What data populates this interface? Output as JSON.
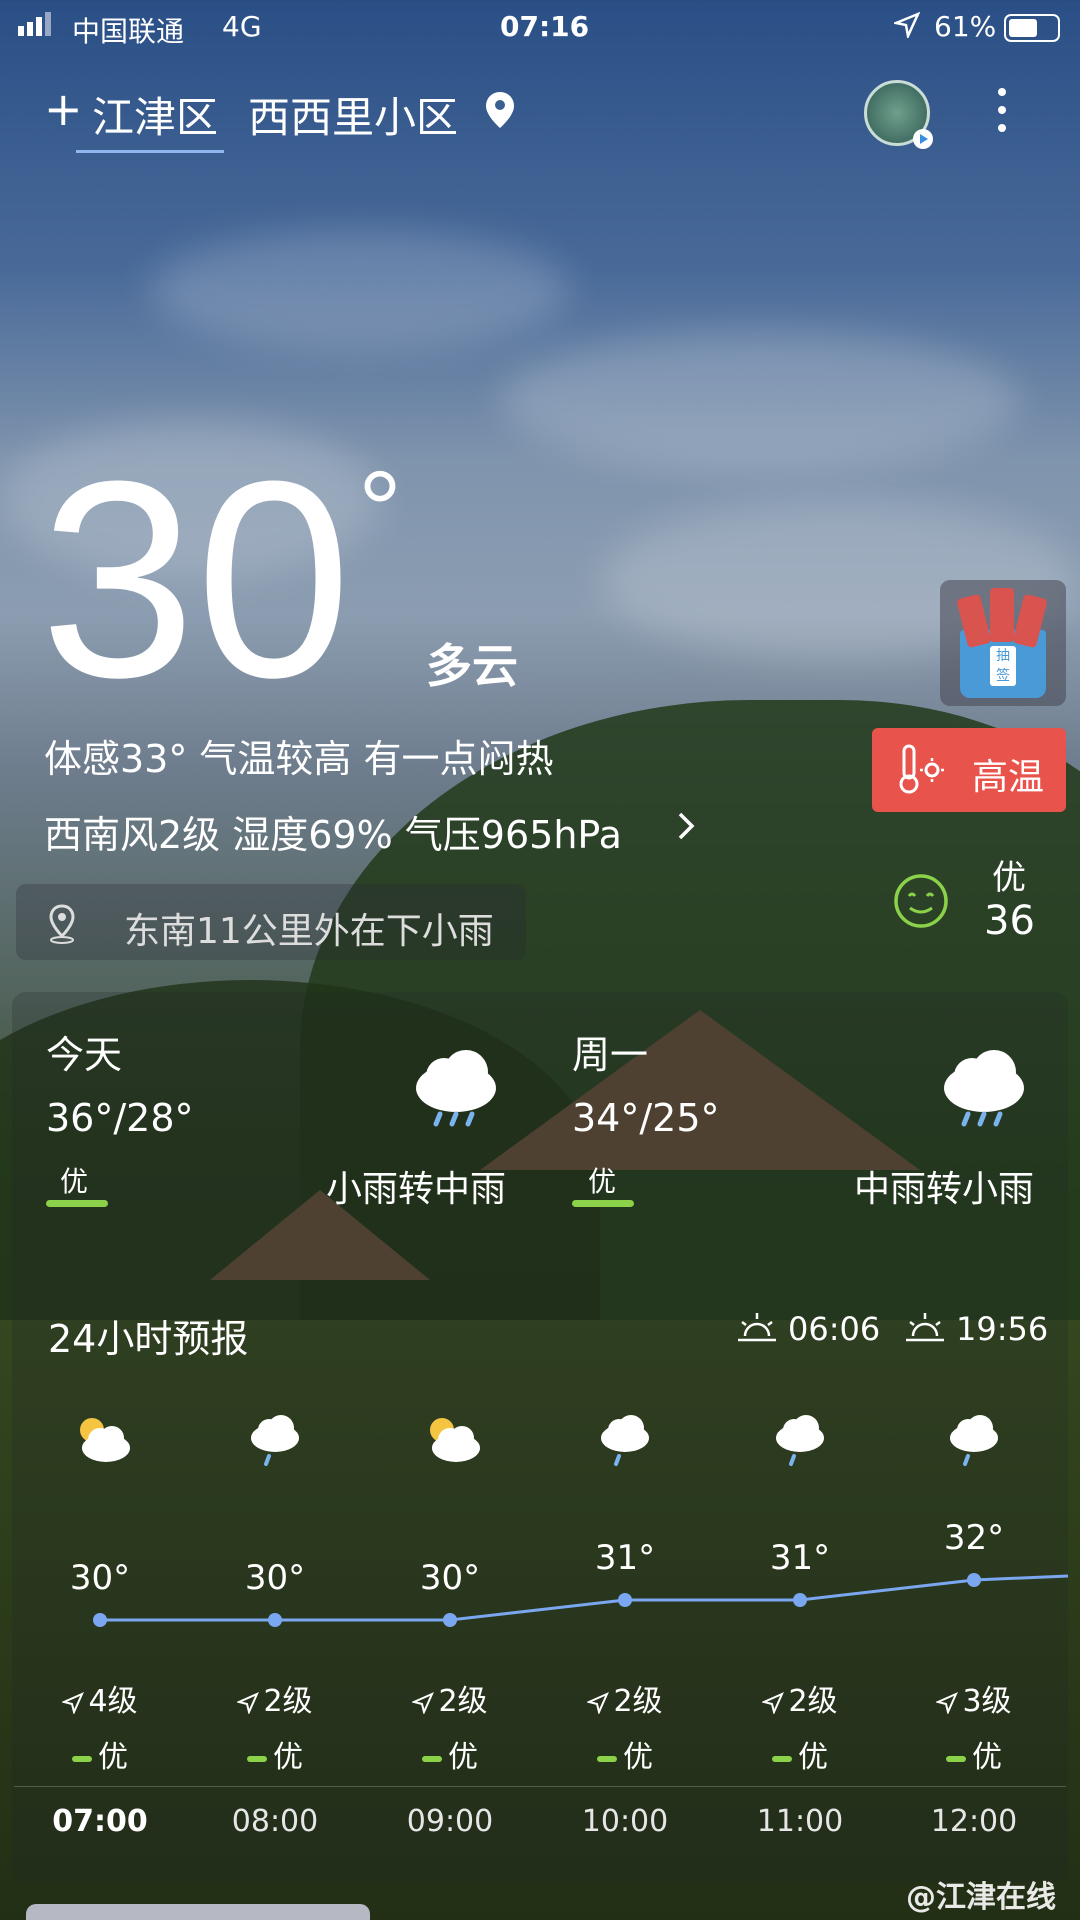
{
  "status": {
    "carrier": "中国联通",
    "network": "4G",
    "time": "07:16",
    "battery": "61%"
  },
  "header": {
    "add": "+",
    "district": "江津区",
    "community": "西西里小区"
  },
  "current": {
    "temp": "30",
    "degree": "°",
    "condition": "多云",
    "feels": "体感33° 气温较高 有一点闷热",
    "details": "西南风2级 湿度69% 气压965hPa",
    "rain_notice": "东南11公里外在下小雨"
  },
  "side": {
    "fortune": "抽签",
    "alert": "高温",
    "aqi_label": "优",
    "aqi_value": "36"
  },
  "daily": [
    {
      "day": "今天",
      "range": "36°/28°",
      "aqi": "优",
      "condition": "小雨转中雨"
    },
    {
      "day": "周一",
      "range": "34°/25°",
      "aqi": "优",
      "condition": "中雨转小雨"
    }
  ],
  "hourly_title": "24小时预报",
  "sunrise": "06:06",
  "sunset": "19:56",
  "hours": [
    {
      "temp": "30°",
      "wind": "4级",
      "aqi": "优",
      "time": "07:00",
      "icon": "partly-cloudy-icon"
    },
    {
      "temp": "30°",
      "wind": "2级",
      "aqi": "优",
      "time": "08:00",
      "icon": "rain-icon"
    },
    {
      "temp": "30°",
      "wind": "2级",
      "aqi": "优",
      "time": "09:00",
      "icon": "partly-cloudy-icon"
    },
    {
      "temp": "31°",
      "wind": "2级",
      "aqi": "优",
      "time": "10:00",
      "icon": "rain-icon"
    },
    {
      "temp": "31°",
      "wind": "2级",
      "aqi": "优",
      "time": "11:00",
      "icon": "rain-icon"
    },
    {
      "temp": "32°",
      "wind": "3级",
      "aqi": "优",
      "time": "12:00",
      "icon": "rain-icon"
    }
  ],
  "watermark": "@江津在线",
  "colors": {
    "alert": "#e8534b",
    "aqi_good": "#8bd14a",
    "line": "#7aa7f0"
  }
}
